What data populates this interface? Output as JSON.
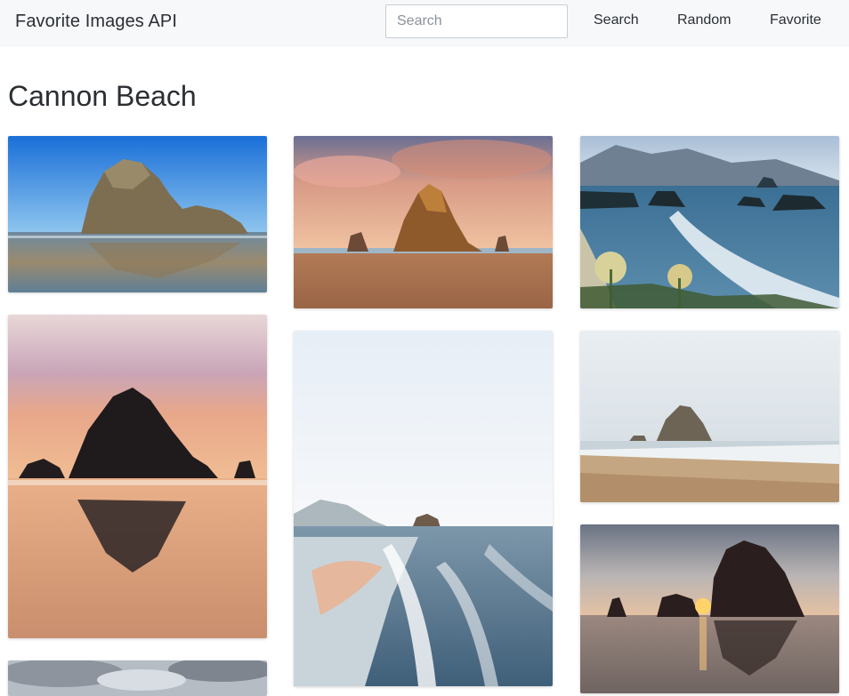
{
  "navbar": {
    "brand": "Favorite Images API",
    "search_placeholder": "Search",
    "links": {
      "search": "Search",
      "random": "Random",
      "favorite": "Favorite"
    }
  },
  "page": {
    "title": "Cannon Beach"
  },
  "gallery": {
    "images": [
      {
        "subject": "haystack-rock-blue-sky-reflection"
      },
      {
        "subject": "haystack-rock-sunset-clouds"
      },
      {
        "subject": "coastline-sea-stacks-wildflowers"
      },
      {
        "subject": "haystack-rock-silhouette-pink-sky"
      },
      {
        "subject": "aerial-misty-beach-waves"
      },
      {
        "subject": "haystack-rock-hazy-shoreline"
      },
      {
        "subject": "haystack-rock-sunburst"
      },
      {
        "subject": "cloudy-sky-partial"
      }
    ]
  }
}
